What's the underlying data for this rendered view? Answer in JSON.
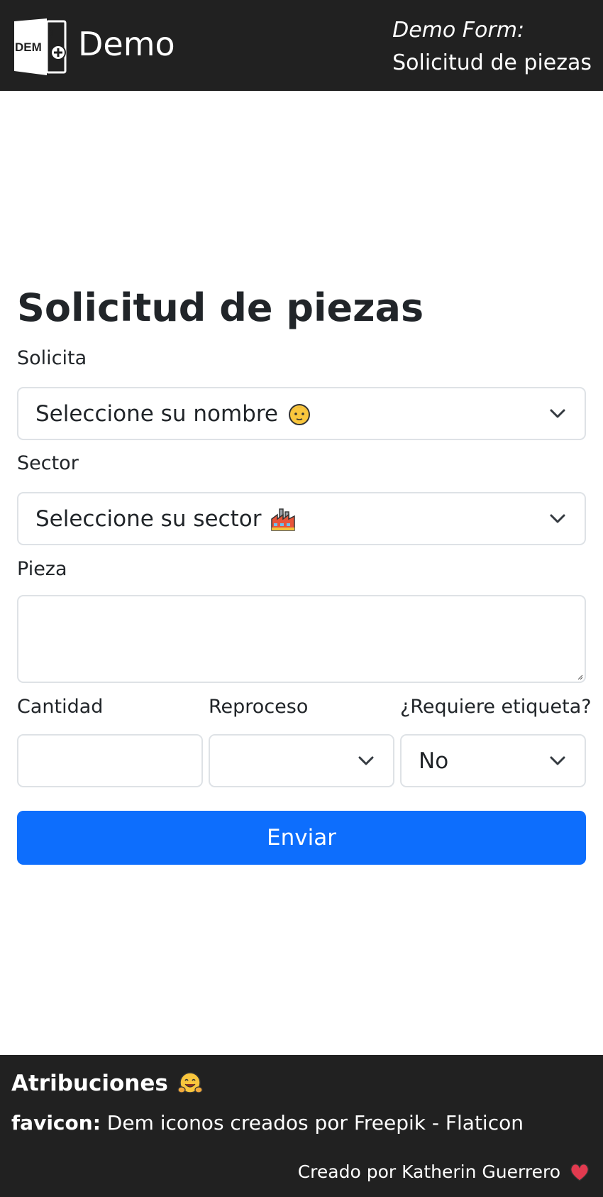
{
  "header": {
    "logo_text": "DEM",
    "brand": "Demo",
    "form_label": "Demo Form:",
    "form_title": "Solicitud de piezas"
  },
  "form": {
    "title": "Solicitud de piezas",
    "solicita": {
      "label": "Solicita",
      "selected": "Seleccione su nombre",
      "icon": "person-face-emoji"
    },
    "sector": {
      "label": "Sector",
      "selected": "Seleccione su sector",
      "icon": "factory-emoji"
    },
    "pieza": {
      "label": "Pieza",
      "value": ""
    },
    "cantidad": {
      "label": "Cantidad",
      "value": ""
    },
    "reproceso": {
      "label": "Reproceso",
      "selected": ""
    },
    "etiqueta": {
      "label": "¿Requiere etiqueta?",
      "selected": "No"
    },
    "submit_label": "Enviar"
  },
  "footer": {
    "heading": "Atribuciones",
    "heading_icon": "hugging-face-emoji",
    "attribution_label": "favicon:",
    "attribution_text": "Dem iconos creados por Freepik - Flaticon",
    "credit": "Creado por Katherin Guerrero",
    "credit_icon": "heart-emoji"
  },
  "colors": {
    "header_bg": "#212121",
    "primary": "#0d6efd",
    "border": "#dee2e6",
    "text": "#212529"
  }
}
